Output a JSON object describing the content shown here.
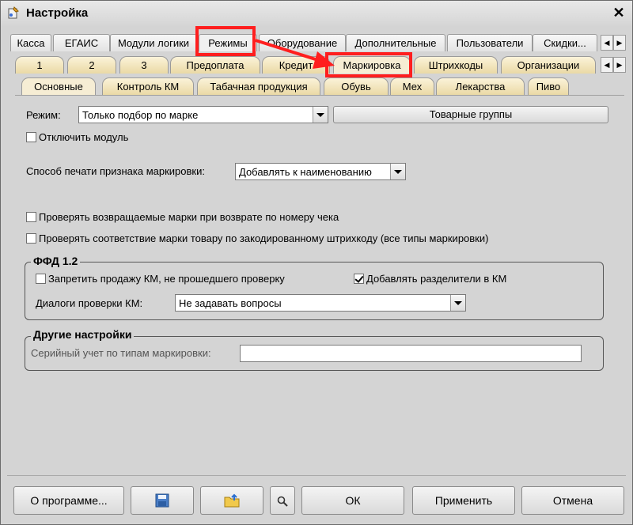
{
  "window": {
    "title": "Настройка",
    "close": "✕"
  },
  "tabs_top": [
    "Касса",
    "ЕГАИС",
    "Модули логики",
    "Режимы",
    "Оборудование",
    "Дополнительные",
    "Пользователи",
    "Скидки..."
  ],
  "tabs_second": [
    "1",
    "2",
    "3",
    "Предоплата",
    "Кредит",
    "Маркировка",
    "Штрихкоды",
    "Организации"
  ],
  "tabs_third": [
    "Основные",
    "Контроль КМ",
    "Табачная продукция",
    "Обувь",
    "Мех",
    "Лекарства",
    "Пиво"
  ],
  "arrows": {
    "left": "◀",
    "right": "▶"
  },
  "mode": {
    "label": "Режим:",
    "value": "Только подбор по марке",
    "groups_button": "Товарные группы"
  },
  "disable_module": {
    "label": "Отключить модуль",
    "checked": false
  },
  "print_method": {
    "label": "Способ печати признака маркировки:",
    "value": "Добавлять к наименованию"
  },
  "checks": {
    "returned": {
      "label": "Проверять возвращаемые марки при возврате по номеру чека",
      "checked": false
    },
    "matching": {
      "label": "Проверять соответствие марки товару по закодированному штрихкоду (все типы маркировки)",
      "checked": false
    }
  },
  "ffd": {
    "title": "ФФД 1.2",
    "forbid": {
      "label": "Запретить продажу КМ, не прошедшего проверку",
      "checked": false
    },
    "separators": {
      "label": "Добавлять разделители в КМ",
      "checked": true
    },
    "dialogs_label": "Диалоги проверки КМ:",
    "dialogs_value": "Не задавать вопросы"
  },
  "other": {
    "title": "Другие настройки",
    "serial_label": "Серийный учет по типам маркировки:",
    "serial_value": ""
  },
  "footer": {
    "about": "О программе...",
    "ok": "ОК",
    "apply": "Применить",
    "cancel": "Отмена"
  },
  "colors": {
    "highlight": "#ff1e1e",
    "tab_yellow": "#ead9a5"
  }
}
